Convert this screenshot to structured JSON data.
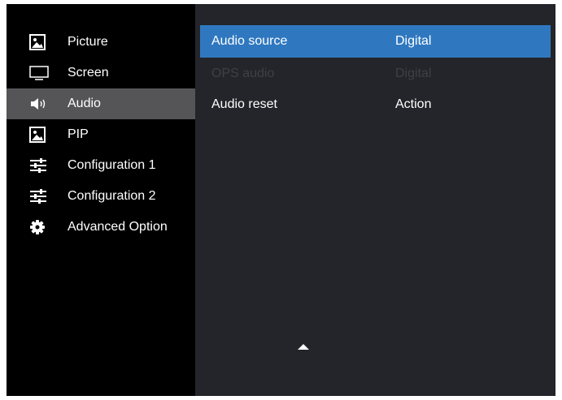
{
  "sidebar": {
    "items": [
      {
        "label": "Picture",
        "icon": "picture-icon"
      },
      {
        "label": "Screen",
        "icon": "monitor-icon"
      },
      {
        "label": "Audio",
        "icon": "speaker-icon"
      },
      {
        "label": "PIP",
        "icon": "picture-icon"
      },
      {
        "label": "Configuration 1",
        "icon": "sliders-icon"
      },
      {
        "label": "Configuration 2",
        "icon": "sliders-icon"
      },
      {
        "label": "Advanced Option",
        "icon": "gear-icon"
      }
    ],
    "active": "Audio"
  },
  "panel": {
    "rows": [
      {
        "name": "Audio source",
        "value": "Digital",
        "state": "selected"
      },
      {
        "name": "OPS audio",
        "value": "Digital",
        "state": "disabled"
      },
      {
        "name": "Audio reset",
        "value": "Action",
        "state": "normal"
      }
    ],
    "scroll_indicator": "triangle-up-icon"
  },
  "colors": {
    "sidebar_bg": "#000000",
    "active_item_bg": "#555558",
    "panel_bg": "#23252a",
    "selected_row_bg": "#2f78c0",
    "disabled_text": "#3d4046"
  }
}
